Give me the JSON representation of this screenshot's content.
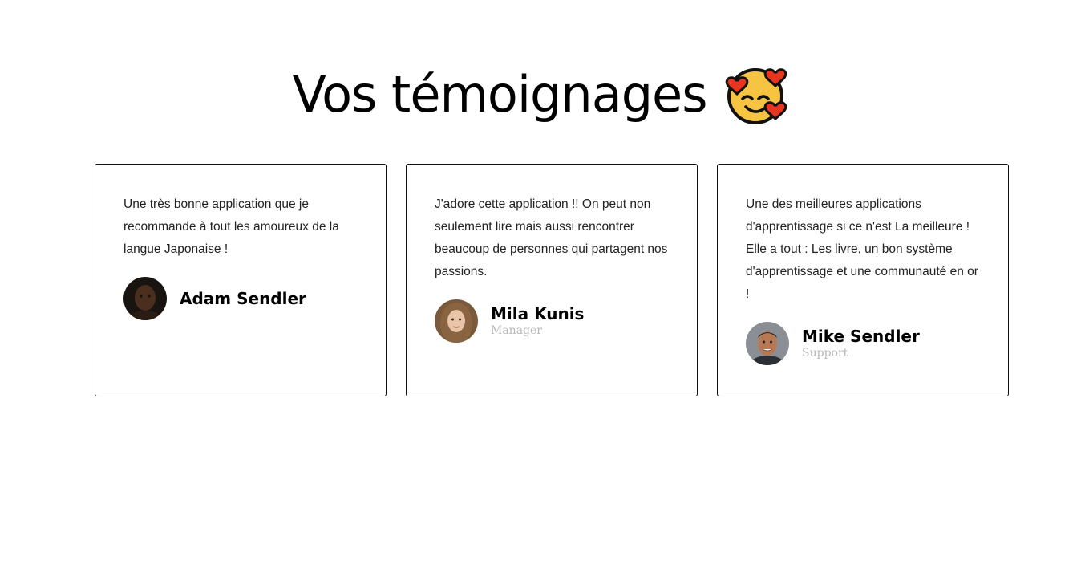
{
  "header": {
    "title": "Vos témoignages",
    "emoji_icon": "smiling-face-with-hearts-icon"
  },
  "testimonials": [
    {
      "quote": "Une très bonne application que je recommande à tout les amoureux de la langue Japonaise !",
      "name": "Adam Sendler",
      "role": ""
    },
    {
      "quote": "J'adore cette application !! On peut non seulement lire mais aussi rencontrer beaucoup de personnes qui partagent nos passions.",
      "name": "Mila Kunis",
      "role": "Manager"
    },
    {
      "quote": "Une des meilleures applications d'apprentissage si ce n'est La meilleure ! Elle a tout : Les livre, un bon système d'apprentissage et une communauté en or !",
      "name": "Mike Sendler",
      "role": "Support"
    }
  ],
  "colors": {
    "card_border": "#111111",
    "role_text": "#b8b8b8",
    "emoji_face": "#f6c343",
    "emoji_heart": "#e8351f"
  }
}
